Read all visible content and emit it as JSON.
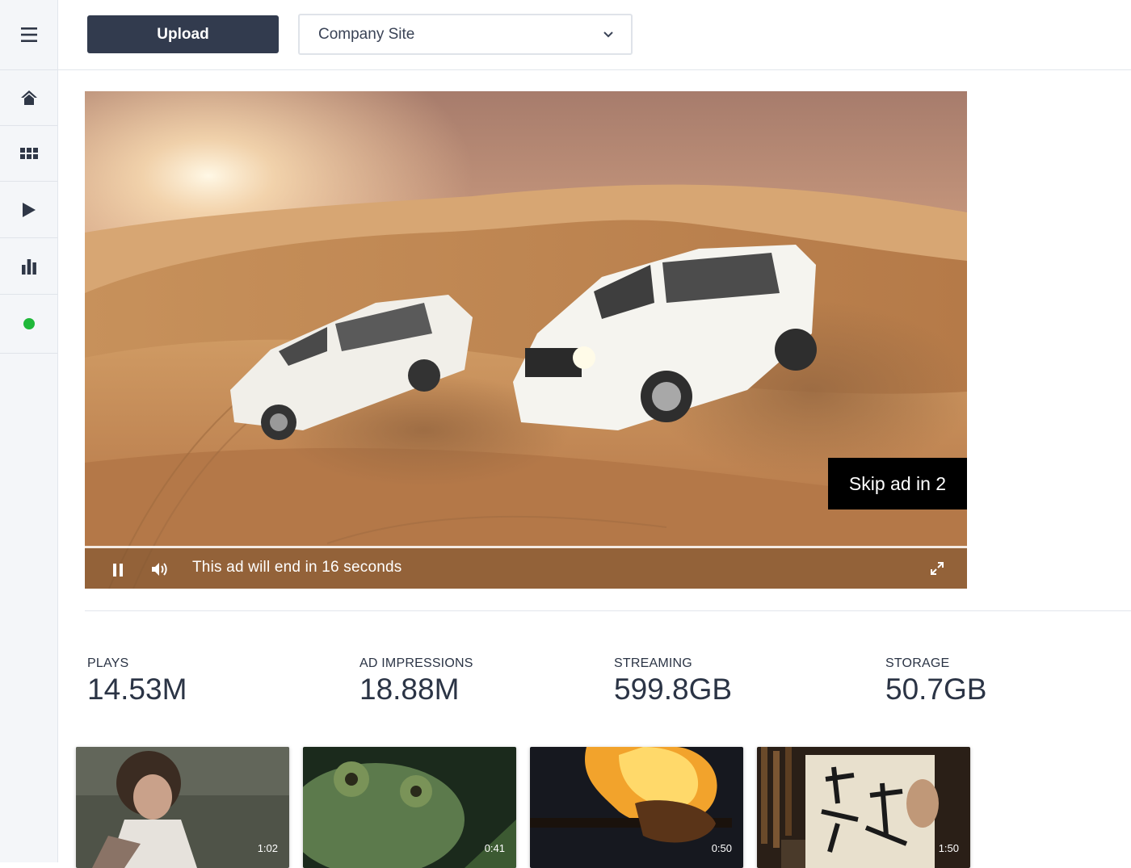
{
  "topbar": {
    "upload_label": "Upload",
    "site_select_value": "Company Site"
  },
  "sidebar": {
    "items": [
      {
        "icon": "menu-icon"
      },
      {
        "icon": "home-icon"
      },
      {
        "icon": "grid-icon"
      },
      {
        "icon": "play-icon"
      },
      {
        "icon": "bar-chart-icon"
      },
      {
        "icon": "status-dot",
        "color": "#1fb83a"
      }
    ]
  },
  "player": {
    "skip_label": "Skip ad in 2",
    "ad_message": "This ad will end in 16 seconds"
  },
  "stats": [
    {
      "label": "PLAYS",
      "value": "14.53M"
    },
    {
      "label": "AD IMPRESSIONS",
      "value": "18.88M"
    },
    {
      "label": "STREAMING",
      "value": "599.8GB"
    },
    {
      "label": "STORAGE",
      "value": "50.7GB"
    }
  ],
  "thumbnails": [
    {
      "duration": "1:02"
    },
    {
      "duration": "0:41"
    },
    {
      "duration": "0:50"
    },
    {
      "duration": "1:50"
    }
  ],
  "colors": {
    "sidebar_bg": "#f4f6f9",
    "upload_bg": "#323b4e",
    "status_green": "#1fb83a"
  }
}
